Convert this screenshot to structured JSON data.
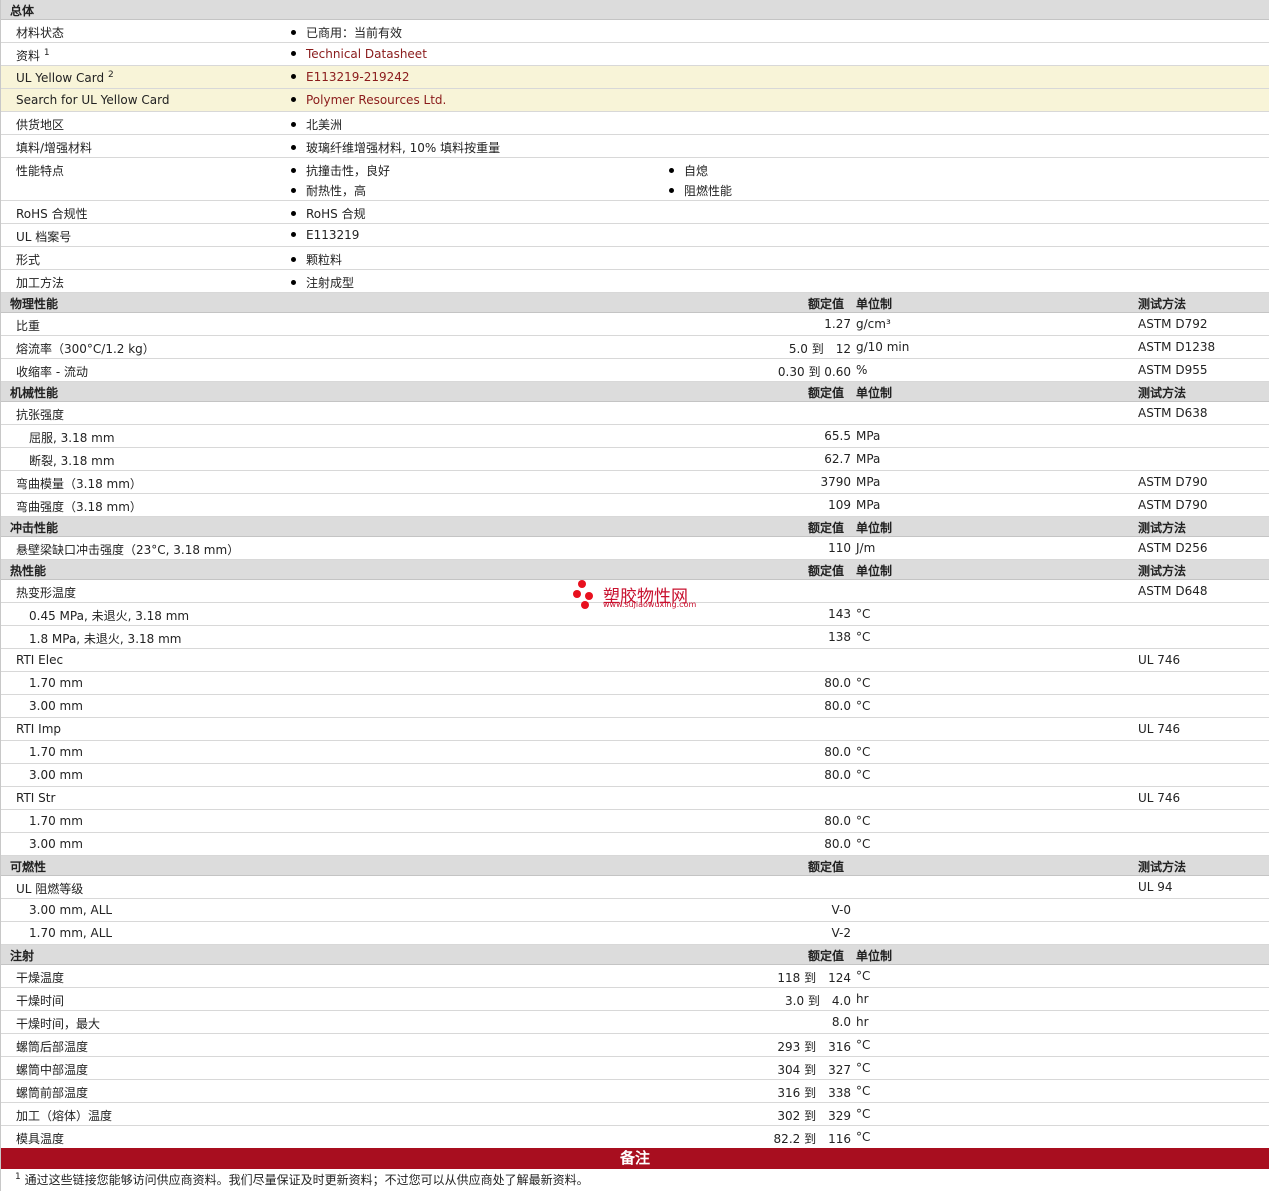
{
  "general": {
    "header": "总体",
    "status_label": "材料状态",
    "status_value": "已商用：当前有效",
    "docs_label": "资料",
    "docs_sup": "1",
    "docs_value": "Technical Datasheet",
    "ulcard_label": "UL Yellow Card",
    "ulcard_sup": "2",
    "ulcard_value": "E113219-219242",
    "search_label": "Search for UL Yellow Card",
    "search_value": "Polymer Resources Ltd.",
    "region_label": "供货地区",
    "region_value": "北美洲",
    "filler_label": "填料/增强材料",
    "filler_value": "玻璃纤维增强材料, 10% 填料按重量",
    "features_label": "性能特点",
    "features": [
      "抗撞击性，良好",
      "自熄",
      "耐热性，高",
      "阻燃性能"
    ],
    "rohs_label": "RoHS 合规性",
    "rohs_value": "RoHS 合规",
    "ulfile_label": "UL 档案号",
    "ulfile_value": "E113219",
    "form_label": "形式",
    "form_value": "颗粒料",
    "proc_label": "加工方法",
    "proc_value": "注射成型"
  },
  "headers": {
    "nominal": "额定值",
    "unit": "单位制",
    "test": "测试方法"
  },
  "physical": {
    "title": "物理性能",
    "rows": [
      {
        "label": "比重",
        "value": "1.27",
        "unit": "g/cm³",
        "test": "ASTM D792"
      },
      {
        "label": "熔流率（300°C/1.2 kg）",
        "value": "5.0 到　12",
        "unit": "g/10 min",
        "test": "ASTM D1238"
      },
      {
        "label": "收缩率 - 流动",
        "value": "0.30 到 0.60",
        "unit": "%",
        "test": "ASTM D955"
      }
    ]
  },
  "mechanical": {
    "title": "机械性能",
    "tensile": "抗张强度",
    "tensile_test": "ASTM D638",
    "yield_label": "屈服, 3.18 mm",
    "yield_value": "65.5",
    "yield_unit": "MPa",
    "break_label": "断裂, 3.18 mm",
    "break_value": "62.7",
    "break_unit": "MPa",
    "fmod_label": "弯曲模量（3.18 mm）",
    "fmod_value": "3790",
    "fmod_unit": "MPa",
    "fmod_test": "ASTM D790",
    "fstr_label": "弯曲强度（3.18 mm）",
    "fstr_value": "109",
    "fstr_unit": "MPa",
    "fstr_test": "ASTM D790"
  },
  "impact": {
    "title": "冲击性能",
    "izod_label": "悬壁梁缺口冲击强度（23°C, 3.18 mm）",
    "izod_value": "110",
    "izod_unit": "J/m",
    "izod_test": "ASTM D256"
  },
  "thermal": {
    "title": "热性能",
    "hdt_label": "热变形温度",
    "hdt_test": "ASTM D648",
    "hdt1_label": "0.45 MPa, 未退火, 3.18 mm",
    "hdt1_value": "143",
    "hdt1_unit": "°C",
    "hdt2_label": "1.8 MPa, 未退火, 3.18 mm",
    "hdt2_value": "138",
    "hdt2_unit": "°C",
    "rti_elec": "RTI Elec",
    "rti_imp": "RTI Imp",
    "rti_str": "RTI Str",
    "rti_test": "UL 746",
    "t170": "1.70 mm",
    "t300": "3.00 mm",
    "rti_value": "80.0",
    "rti_unit": "°C"
  },
  "flammability": {
    "title": "可燃性",
    "ul_label": "UL 阻燃等级",
    "ul_test": "UL 94",
    "r1_label": "3.00 mm, ALL",
    "r1_value": "V-0",
    "r2_label": "1.70 mm, ALL",
    "r2_value": "V-2"
  },
  "injection": {
    "title": "注射",
    "rows": [
      {
        "label": "干燥温度",
        "value": "118 到　124",
        "unit": "°C"
      },
      {
        "label": "干燥时间",
        "value": "3.0 到　4.0",
        "unit": "hr"
      },
      {
        "label": "干燥时间，最大",
        "value": "8.0",
        "unit": "hr"
      },
      {
        "label": "螺筒后部温度",
        "value": "293 到　316",
        "unit": "°C"
      },
      {
        "label": "螺筒中部温度",
        "value": "304 到　327",
        "unit": "°C"
      },
      {
        "label": "螺筒前部温度",
        "value": "316 到　338",
        "unit": "°C"
      },
      {
        "label": "加工（熔体）温度",
        "value": "302 到　329",
        "unit": "°C"
      },
      {
        "label": "模具温度",
        "value": "82.2 到　116",
        "unit": "°C"
      }
    ]
  },
  "notes": {
    "title": "备注",
    "sup": "1",
    "text": "通过这些链接您能够访问供应商资料。我们尽量保证及时更新资料；不过您可以从供应商处了解最新资料。"
  },
  "watermark": {
    "name": "塑胶物性网",
    "url": "www.sujiaowuxing.com"
  }
}
